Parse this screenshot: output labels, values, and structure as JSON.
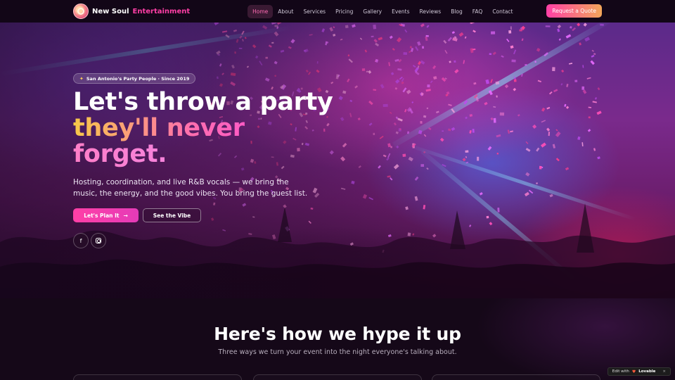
{
  "nav": {
    "brand_name": "New Soul",
    "brand_accent": "Entertainment",
    "links": [
      "Home",
      "About",
      "Services",
      "Pricing",
      "Gallery",
      "Events",
      "Reviews",
      "Blog",
      "FAQ",
      "Contact"
    ],
    "active_index": 0,
    "cta_label": "Request a Quote"
  },
  "hero": {
    "badge_icon": "party-popper-icon",
    "badge_text": "San Antonio's Party People · Since 2019",
    "headline_line1": "Let's throw a party",
    "headline_line2": "they'll never",
    "headline_line3": "forget.",
    "subtext": "Hosting, coordination, and live R&B vocals — we bring the music, the energy, and the good vibes. You bring the guest list.",
    "primary_button": "Let's Plan It",
    "primary_button_icon": "arrow-right-icon",
    "secondary_button": "See the Vibe",
    "social_icons": [
      "facebook-icon",
      "instagram-icon"
    ]
  },
  "section": {
    "title": "Here's how we hype it up",
    "subtitle": "Three ways we turn your event into the night everyone's talking about."
  },
  "badge_widget": {
    "prefix": "Edit with",
    "brand": "Lovable",
    "close": "×"
  },
  "colors": {
    "accent_pink": "#ff3fa6",
    "accent_gold": "#f7c948",
    "nav_bg": "#120618",
    "section_bg": "#150818"
  }
}
